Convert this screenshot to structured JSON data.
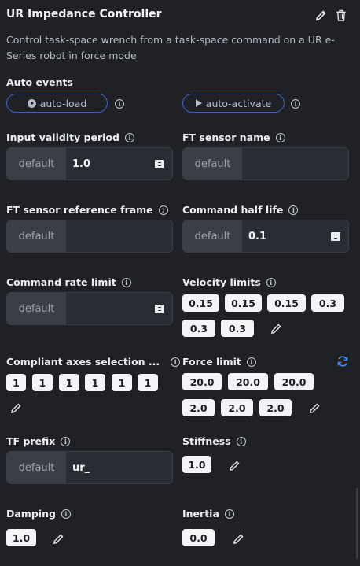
{
  "header": {
    "title": "UR Impedance Controller",
    "description": "Control task-space wrench from a task-space command on a UR e-Series robot in force mode"
  },
  "auto_events": {
    "label": "Auto events",
    "load": "auto-load",
    "activate": "auto-activate"
  },
  "default_label": "default",
  "fields": {
    "input_validity_period": {
      "label": "Input validity period",
      "value": "1.0"
    },
    "ft_sensor_name": {
      "label": "FT sensor name",
      "value": ""
    },
    "ft_sensor_reference_frame": {
      "label": "FT sensor reference frame",
      "value": ""
    },
    "command_half_life": {
      "label": "Command half life",
      "value": "0.1"
    },
    "command_rate_limit": {
      "label": "Command rate limit",
      "value": ""
    },
    "tf_prefix": {
      "label": "TF prefix",
      "value": "ur_"
    }
  },
  "velocity_limits": {
    "label": "Velocity limits",
    "values": [
      "0.15",
      "0.15",
      "0.15",
      "0.3",
      "0.3",
      "0.3"
    ]
  },
  "compliant_axes": {
    "label": "Compliant axes selection ...",
    "values": [
      "1",
      "1",
      "1",
      "1",
      "1",
      "1"
    ]
  },
  "force_limit": {
    "label": "Force limit",
    "values": [
      "20.0",
      "20.0",
      "20.0",
      "2.0",
      "2.0",
      "2.0"
    ]
  },
  "stiffness": {
    "label": "Stiffness",
    "values": [
      "1.0"
    ]
  },
  "damping": {
    "label": "Damping",
    "values": [
      "1.0"
    ]
  },
  "inertia": {
    "label": "Inertia",
    "values": [
      "0.0"
    ]
  },
  "info_glyph": "i",
  "colors": {
    "background": "#1f2127",
    "accent": "#3a66c9",
    "refresh": "#4a8cf0"
  }
}
